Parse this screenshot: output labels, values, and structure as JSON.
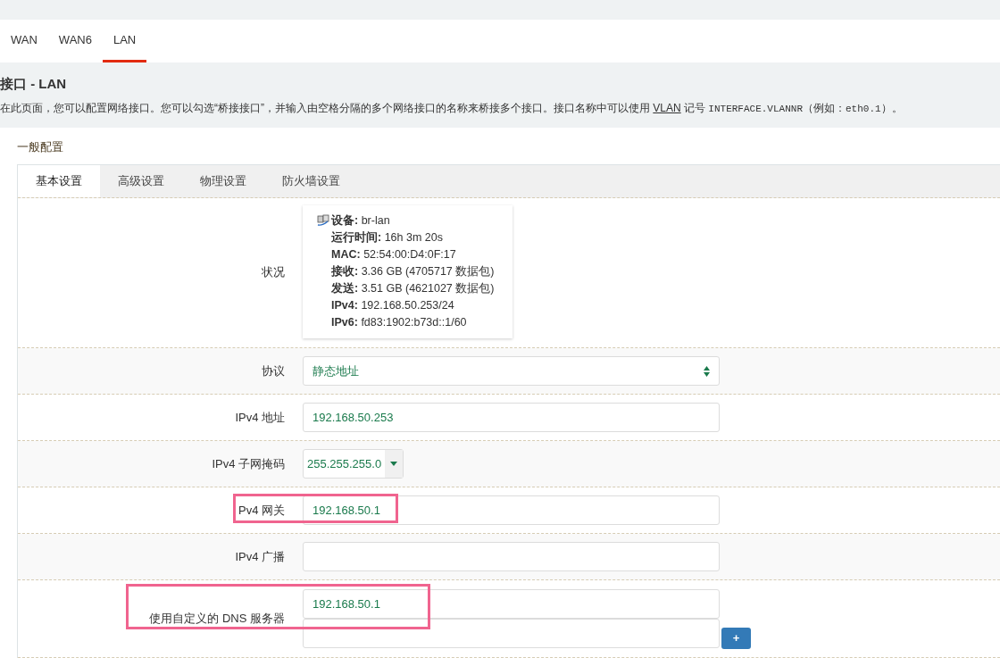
{
  "top_tabs": [
    {
      "label": "WAN",
      "selected": false
    },
    {
      "label": "WAN6",
      "selected": false
    },
    {
      "label": "LAN",
      "selected": true
    }
  ],
  "title": "接口 - LAN",
  "description": [
    {
      "kind": "text",
      "text": "在此页面，您可以配置网络接口。您可以勾选“桥接接口”，并输入由空格分隔的多个网络接口的名称来桥接多个接口。接口名称中可以使用 "
    },
    {
      "kind": "link",
      "text": "VLAN"
    },
    {
      "kind": "text",
      "text": " 记号 "
    },
    {
      "kind": "code",
      "text": "INTERFACE.VLANNR"
    },
    {
      "kind": "text",
      "text": "（例如："
    },
    {
      "kind": "code",
      "text": "eth0.1"
    },
    {
      "kind": "text",
      "text": "）。"
    }
  ],
  "section_title": "一般配置",
  "section_tabs": [
    {
      "label": "基本设置",
      "selected": true
    },
    {
      "label": "高级设置",
      "selected": false
    },
    {
      "label": "物理设置",
      "selected": false
    },
    {
      "label": "防火墙设置",
      "selected": false
    }
  ],
  "rows": [
    {
      "kind": "status",
      "label": "状况",
      "lines": [
        {
          "label": "设备:",
          "value": "br-lan"
        },
        {
          "label": "运行时间:",
          "value": "16h 3m 20s"
        },
        {
          "label": "MAC:",
          "value": "52:54:00:D4:0F:17"
        },
        {
          "label": "接收:",
          "value": "3.36 GB (4705717 数据包)"
        },
        {
          "label": "发送:",
          "value": "3.51 GB (4621027 数据包)"
        },
        {
          "label": "IPv4:",
          "value": "192.168.50.253/24"
        },
        {
          "label": "IPv6:",
          "value": "fd83:1902:b73d::1/60"
        }
      ]
    },
    {
      "kind": "select",
      "label": "协议",
      "value": "静态地址"
    },
    {
      "kind": "input",
      "label": "IPv4 地址",
      "value": "192.168.50.253"
    },
    {
      "kind": "combo",
      "label": "IPv4 子网掩码",
      "value": "255.255.255.0"
    },
    {
      "kind": "input",
      "label": "Pv4 网关",
      "value": "192.168.50.1",
      "highlighted": true
    },
    {
      "kind": "input",
      "label": "IPv4 广播"
    },
    {
      "kind": "multi",
      "label": "使用自定义的 DNS 服务器",
      "fields": [
        {
          "kind": "filled",
          "value": "192.168.50.1"
        },
        {
          "kind": "blank"
        }
      ],
      "add_button": "+",
      "highlighted": true
    }
  ]
}
